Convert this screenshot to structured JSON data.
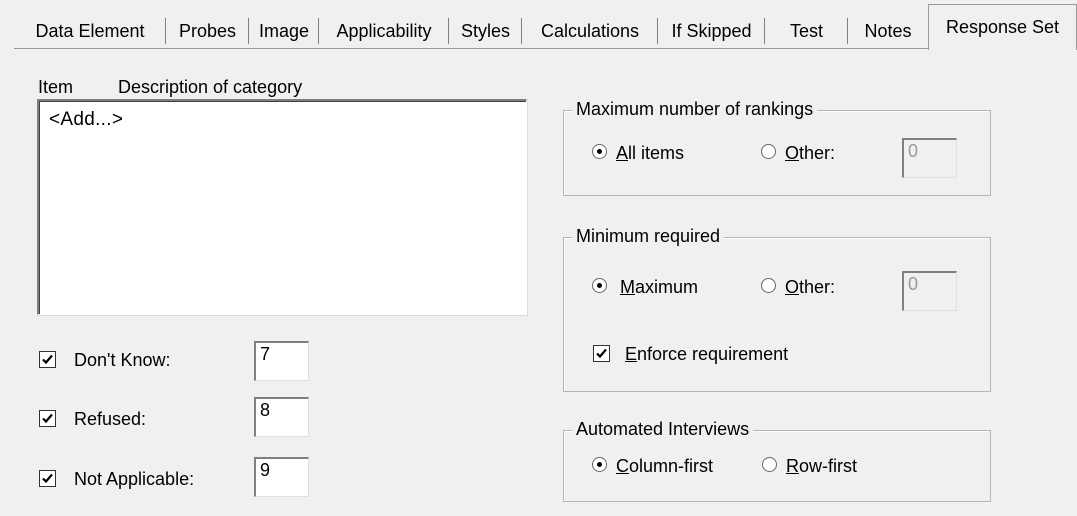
{
  "tabs": [
    {
      "label": "Data Element"
    },
    {
      "label": "Probes"
    },
    {
      "label": "Image"
    },
    {
      "label": "Applicability"
    },
    {
      "label": "Styles"
    },
    {
      "label": "Calculations"
    },
    {
      "label": "If Skipped"
    },
    {
      "label": "Test"
    },
    {
      "label": "Notes"
    },
    {
      "label": "Response Set",
      "active": true
    }
  ],
  "list": {
    "col_item": "Item",
    "col_description": "Description of category",
    "items": [
      "<Add...>"
    ]
  },
  "special_codes": [
    {
      "label": "Don't Know:",
      "checked": true,
      "value": "7"
    },
    {
      "label": "Refused:",
      "checked": true,
      "value": "8"
    },
    {
      "label": "Not Applicable:",
      "checked": true,
      "value": "9"
    }
  ],
  "max_rankings": {
    "legend": "Maximum number of rankings",
    "option_all": "All items",
    "option_other": "Other:",
    "selected": "all",
    "other_value": "0"
  },
  "min_required": {
    "legend": "Minimum required",
    "option_max": "Maximum",
    "option_other": "Other:",
    "selected": "maximum",
    "other_value": "0",
    "enforce_label": "Enforce requirement",
    "enforce_checked": true
  },
  "automated": {
    "legend": "Automated Interviews",
    "option_column": "Column-first",
    "option_row": "Row-first",
    "selected": "column"
  }
}
